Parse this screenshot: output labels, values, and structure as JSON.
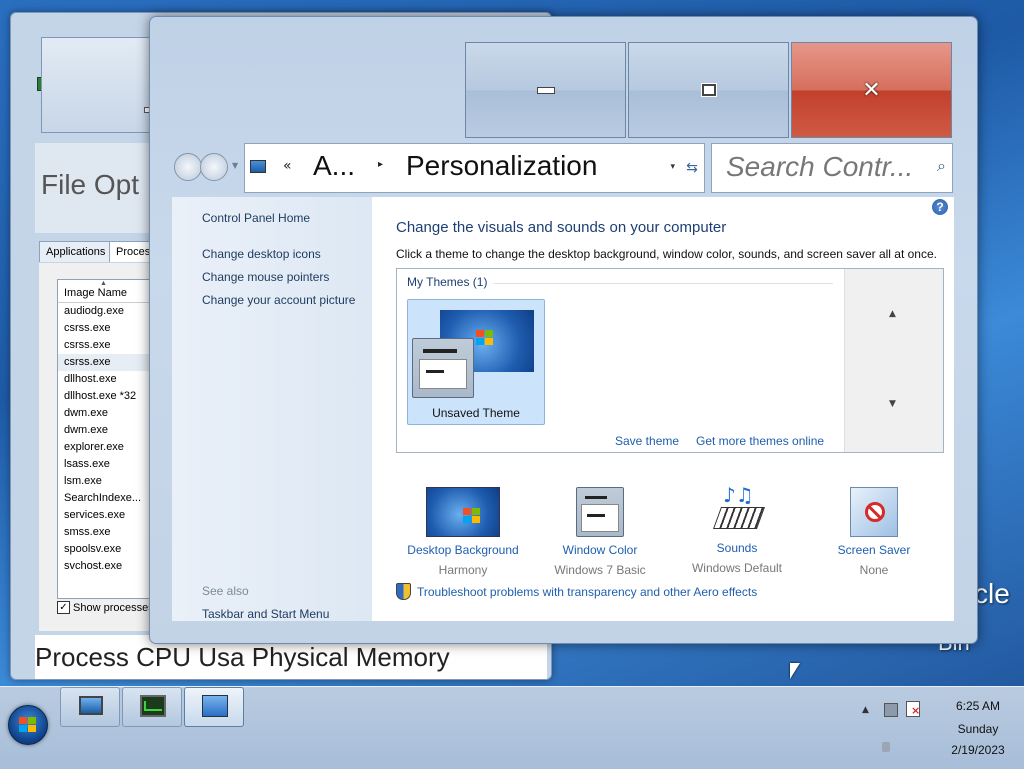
{
  "desktop": {
    "partial_texts": [
      "cle",
      "Bin"
    ]
  },
  "task_manager": {
    "menu_partial": "File Opt",
    "tabs": [
      "Applications",
      "Processes"
    ],
    "list_header": "Image Name",
    "processes": [
      "audiodg.exe",
      "csrss.exe",
      "csrss.exe",
      "csrss.exe",
      "dllhost.exe",
      "dllhost.exe *32",
      "dwm.exe",
      "dwm.exe",
      "explorer.exe",
      "lsass.exe",
      "lsm.exe",
      "SearchIndexe...",
      "services.exe",
      "smss.exe",
      "spoolsv.exe",
      "svchost.exe"
    ],
    "show_processes_label": "Show processes",
    "status_partial": "Process CPU Usa Physical Memory"
  },
  "control_panel": {
    "window": {
      "close_glyph": "✕"
    },
    "address": {
      "chevrons": "«",
      "crumb_parent": "A...",
      "separator": "▸",
      "crumb_current": "Personalization",
      "dropdown": "▾",
      "refresh": "⇆"
    },
    "search": {
      "placeholder": "Search Contr...",
      "icon": "⌕"
    },
    "sidebar": {
      "home": "Control Panel Home",
      "links": [
        "Change desktop icons",
        "Change mouse pointers",
        "Change your account picture"
      ],
      "see_also_heading": "See also",
      "see_also_links": [
        "Taskbar and Start Menu"
      ]
    },
    "content": {
      "help_icon": "?",
      "heading": "Change the visuals and sounds on your computer",
      "description": "Click a theme to change the desktop background, window color, sounds, and screen saver all at once.",
      "themes": {
        "group_label": "My Themes (1)",
        "items": [
          {
            "name": "Unsaved Theme"
          }
        ],
        "save_link": "Save theme",
        "more_link": "Get more themes online",
        "scroll_up": "▲",
        "scroll_down": "▼"
      },
      "options": [
        {
          "label": "Desktop Background",
          "value": "Harmony"
        },
        {
          "label": "Window Color",
          "value": "Windows 7 Basic"
        },
        {
          "label": "Sounds",
          "value": "Windows Default"
        },
        {
          "label": "Screen Saver",
          "value": "None"
        }
      ],
      "troubleshoot_link": "Troubleshoot problems with transparency and other Aero effects",
      "sounds_notes": "♪♫"
    }
  },
  "taskbar": {
    "tray_arrow": "▲",
    "clock": {
      "time": "6:25 AM",
      "day": "Sunday",
      "date": "2/19/2023"
    }
  },
  "colors": {
    "link": "#1f5fae",
    "heading": "#1e3f74",
    "close_button": "#c2402c"
  }
}
